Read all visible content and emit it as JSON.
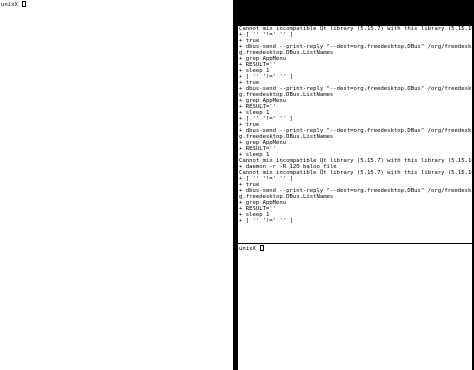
{
  "left_terminal": {
    "prompt": "unixX "
  },
  "right_terminal": {
    "lines": [
      "Cannot mix incompatible Qt library (5.15.7) with this library (5.15.10)",
      "+ [ '' '!=' '' ]",
      "+ true",
      "+ dbus-send --print-reply \"--dest=org.freedesktop.DBus\" /org/freedesktop/DBus or",
      "g.freedesktop.DBus.ListNames",
      "+ grep AppMenu",
      "+ RESULT=''",
      "+ sleep 1",
      "+ [ '' '!=' '' ]",
      "+ true",
      "+ dbus-send --print-reply \"--dest=org.freedesktop.DBus\" /org/freedesktop/DBus or",
      "g.freedesktop.DBus.ListNames",
      "+ grep AppMenu",
      "+ RESULT=''",
      "+ sleep 1",
      "+ [ '' '!=' '' ]",
      "+ true",
      "+ dbus-send --print-reply \"--dest=org.freedesktop.DBus\" /org/freedesktop/DBus or",
      "g.freedesktop.DBus.ListNames",
      "+ grep AppMenu",
      "+ RESULT=''",
      "+ sleep 1",
      "Cannot mix incompatible Qt library (5.15.7) with this library (5.15.10)",
      "+ daemon -r -R 120 baloo_file",
      "Cannot mix incompatible Qt library (5.15.7) with this library (5.15.10)",
      "+ [ '' '!=' '' ]",
      "+ true",
      "+ dbus-send --print-reply \"--dest=org.freedesktop.DBus\" /org/freedesktop/DBus or",
      "g.freedesktop.DBus.ListNames",
      "+ grep AppMenu",
      "+ RESULT=''",
      "+ sleep 1",
      "+ [ '' '!=' '' ]"
    ]
  },
  "right_bottom_terminal": {
    "prompt": "unixX "
  }
}
